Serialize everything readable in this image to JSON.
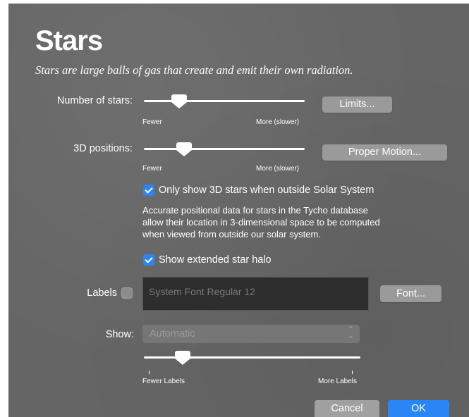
{
  "header": {
    "title": "Stars",
    "subtitle": "Stars are large balls of gas that create and emit their own radiation."
  },
  "number_of_stars": {
    "label": "Number of stars:",
    "min_label": "Fewer",
    "max_label": "More (slower)",
    "value": 0.22,
    "button_label": "Limits..."
  },
  "positions_3d": {
    "label": "3D positions:",
    "min_label": "Fewer",
    "max_label": "More (slower)",
    "value": 0.25,
    "button_label": "Proper Motion..."
  },
  "only_3d_outside": {
    "checked": true,
    "label": "Only show 3D stars when outside Solar System"
  },
  "description": {
    "line1": "Accurate positional data for stars in the Tycho database",
    "line2": "allow their location in 3-dimensional space to be computed",
    "line3": "when viewed from outside our solar system."
  },
  "extended_halo": {
    "checked": true,
    "label": "Show extended star halo"
  },
  "labels": {
    "label": "Labels",
    "checked": false,
    "font_value": "System Font Regular 12",
    "font_button_label": "Font..."
  },
  "show": {
    "label": "Show:",
    "selected": "Automatic",
    "chevrons": "⌃⌄"
  },
  "label_density": {
    "min_label": "Fewer Labels",
    "max_label": "More Labels",
    "value": 0.18
  },
  "footer": {
    "cancel_label": "Cancel",
    "ok_label": "OK"
  },
  "colors": {
    "panel_bg": "#656565",
    "accent": "#2b86f5",
    "button_bg": "#9a9a9a"
  }
}
